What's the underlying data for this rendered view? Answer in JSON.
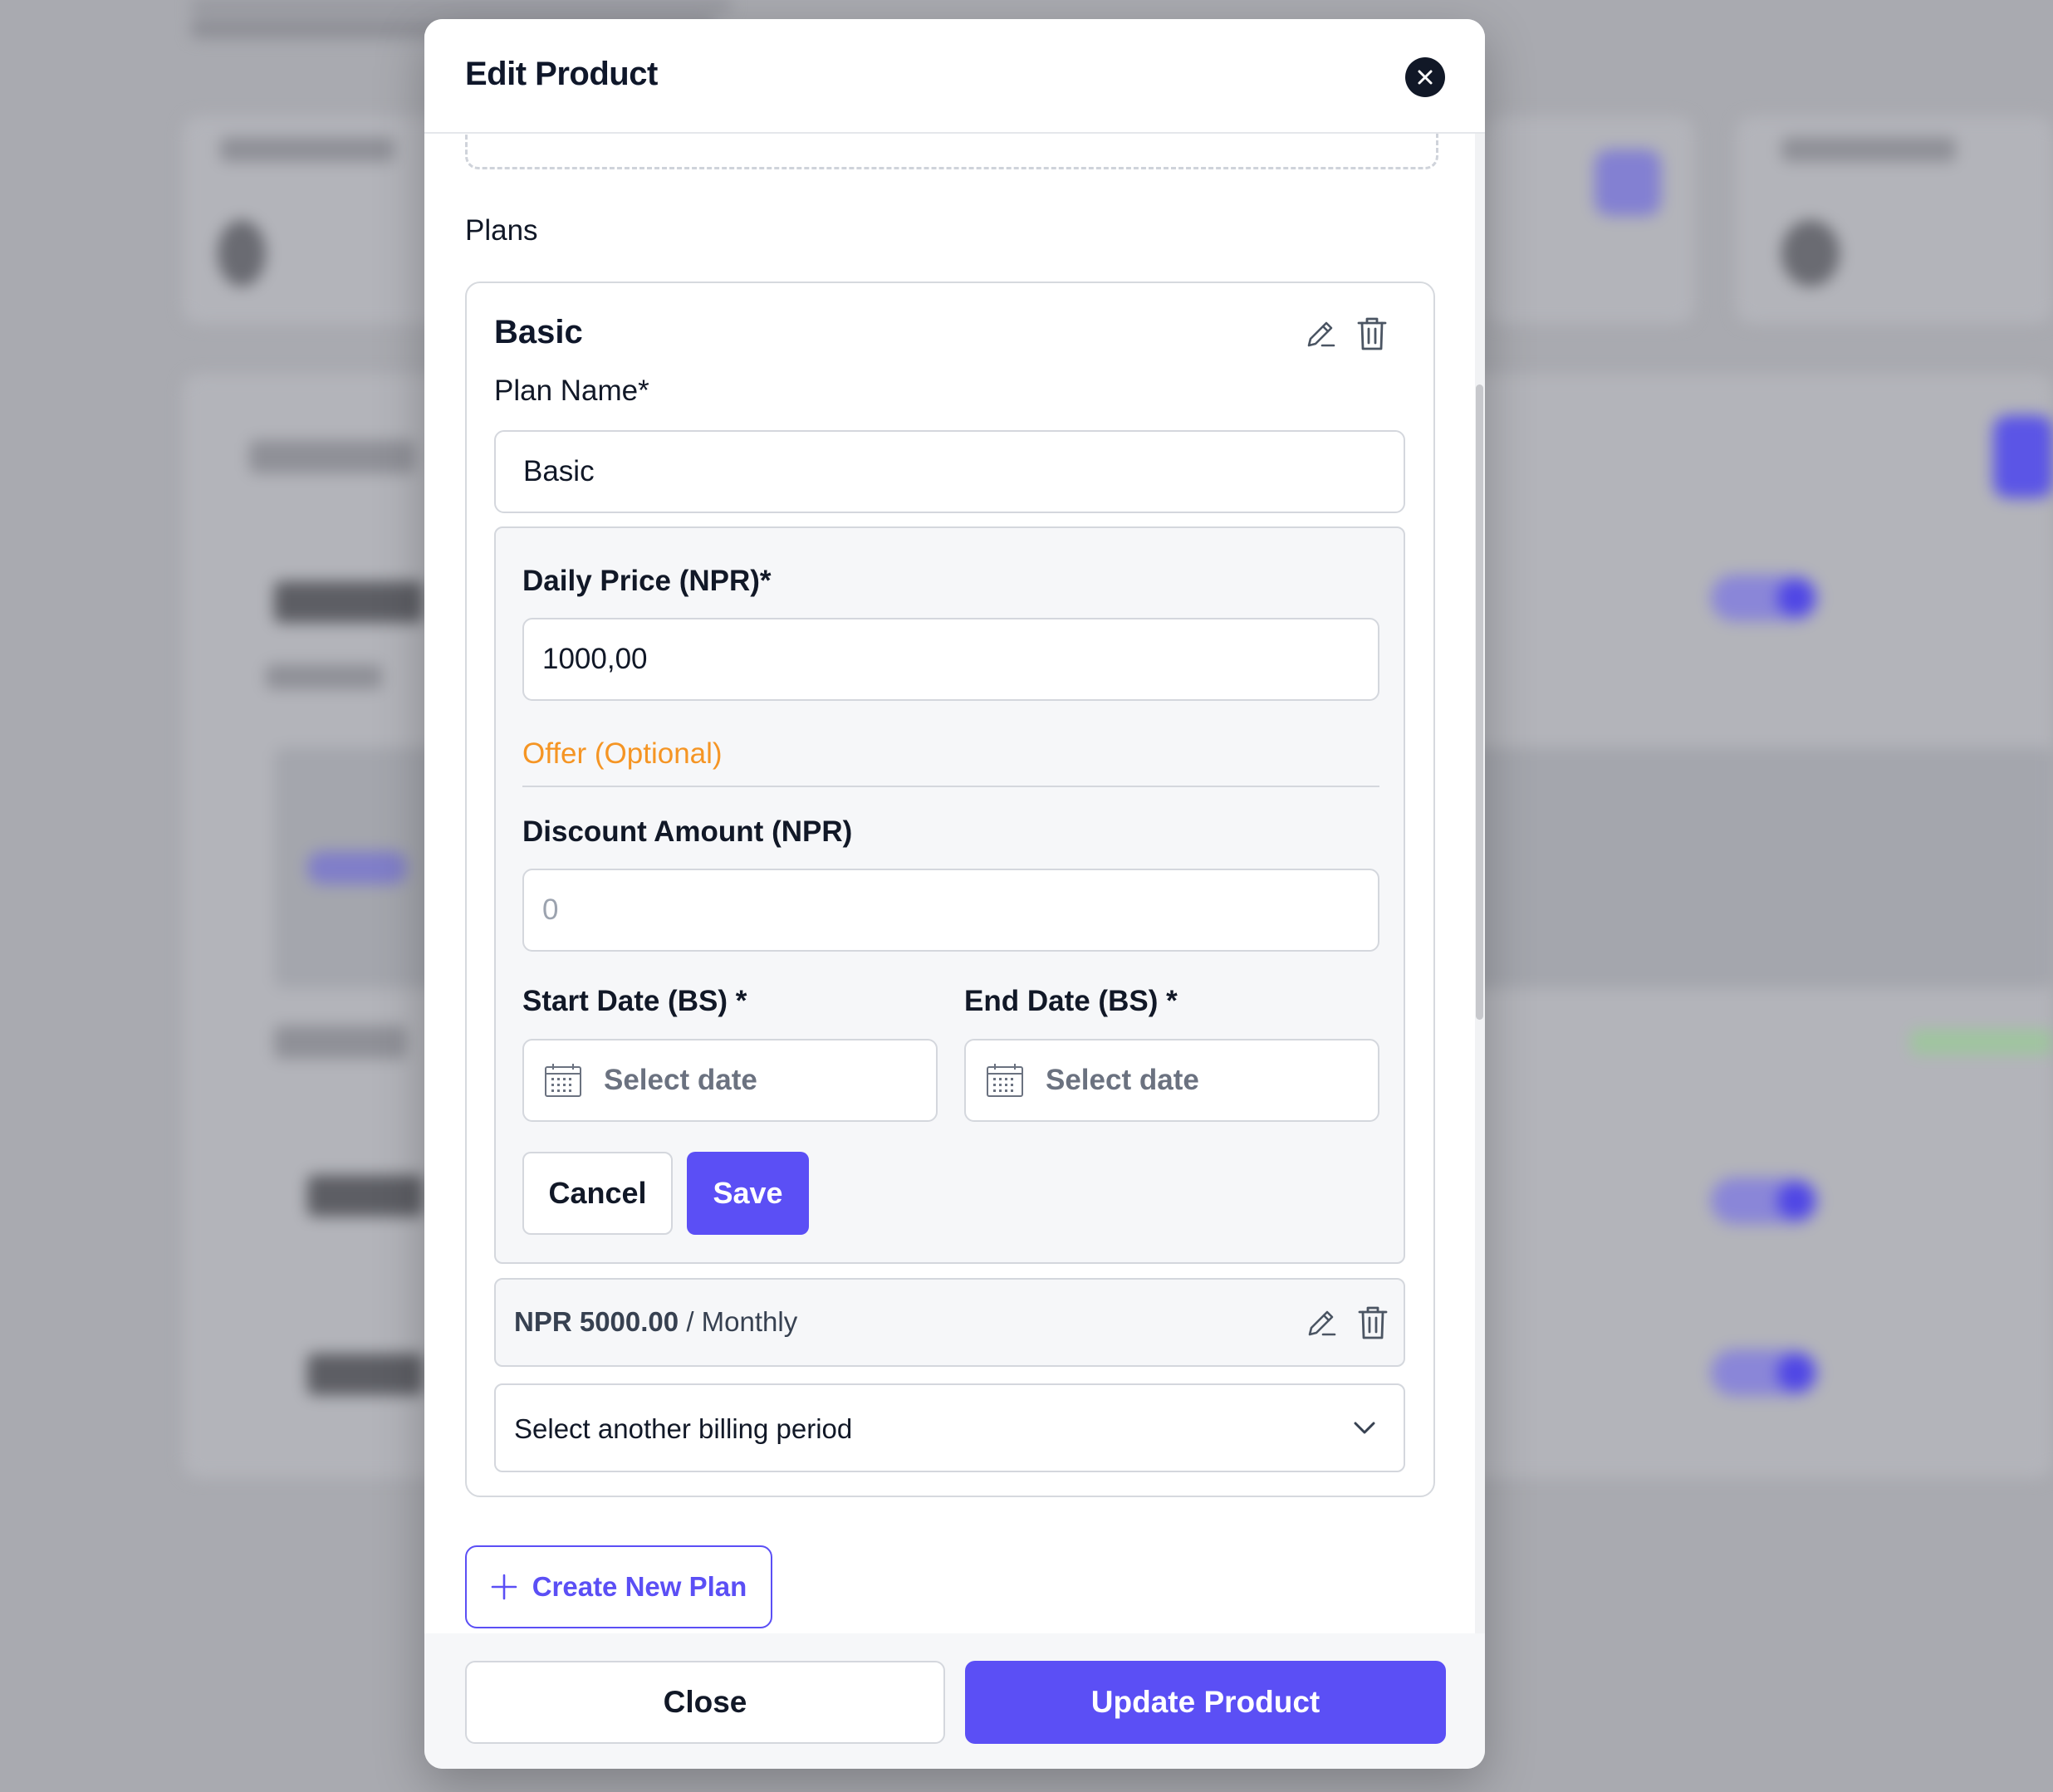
{
  "modal": {
    "title": "Edit Product",
    "close_icon": "close-icon"
  },
  "plans": {
    "section_label": "Plans",
    "plan": {
      "title": "Basic",
      "plan_name_label": "Plan Name*",
      "plan_name_value": "Basic",
      "daily_price_label": "Daily Price (NPR)*",
      "daily_price_value": "1000,00",
      "offer_label": "Offer (Optional)",
      "discount_label": "Discount Amount (NPR)",
      "discount_placeholder": "0",
      "start_date_label": "Start Date (BS) *",
      "start_date_placeholder": "Select date",
      "end_date_label": "End Date (BS) *",
      "end_date_placeholder": "Select date",
      "cancel_label": "Cancel",
      "save_label": "Save",
      "billing": {
        "price": "NPR 5000.00",
        "period": "/ Monthly"
      },
      "select_billing_label": "Select another billing period"
    },
    "create_new_label": "Create New Plan"
  },
  "footer": {
    "close_label": "Close",
    "update_label": "Update Product"
  },
  "colors": {
    "accent": "#5b4ff5",
    "offer": "#f59524"
  }
}
